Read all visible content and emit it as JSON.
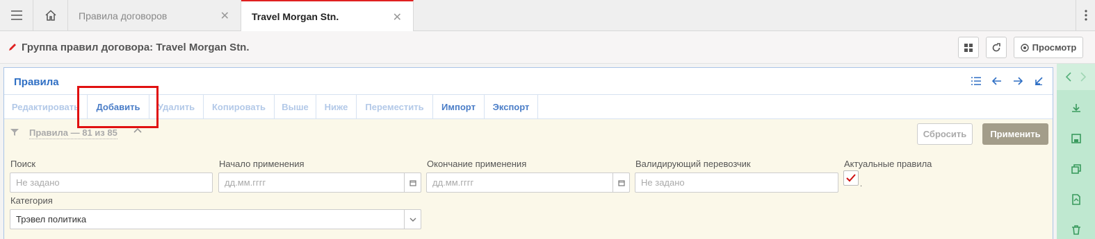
{
  "tabs": [
    {
      "label": "Правила договоров"
    },
    {
      "label": "Travel Morgan Stn."
    }
  ],
  "header": {
    "title": "Группа правил договора: Travel Morgan Stn.",
    "view_label": "Просмотр"
  },
  "panel": {
    "title": "Правила",
    "toolbar": [
      {
        "label": "Редактировать",
        "enabled": false
      },
      {
        "label": "Добавить",
        "enabled": true
      },
      {
        "label": "Удалить",
        "enabled": false
      },
      {
        "label": "Копировать",
        "enabled": false
      },
      {
        "label": "Выше",
        "enabled": false
      },
      {
        "label": "Ниже",
        "enabled": false
      },
      {
        "label": "Переместить",
        "enabled": false
      },
      {
        "label": "Импорт",
        "enabled": true
      },
      {
        "label": "Экспорт",
        "enabled": true
      }
    ]
  },
  "filter": {
    "summary": "Правила — 81 из 85",
    "reset_label": "Сбросить",
    "apply_label": "Применить",
    "search": {
      "label": "Поиск",
      "placeholder": "Не задано"
    },
    "start": {
      "label": "Начало применения",
      "placeholder": "дд.мм.гггг"
    },
    "end": {
      "label": "Окончание применения",
      "placeholder": "дд.мм.гггг"
    },
    "carrier": {
      "label": "Валидирующий перевозчик",
      "placeholder": "Не задано"
    },
    "actual": {
      "label": "Актуальные правила",
      "checked": true
    },
    "category": {
      "label": "Категория",
      "value": "Трэвел политика"
    }
  },
  "colors": {
    "accent": "#2f6fc4",
    "active_tab_border": "#e02020",
    "highlight": "#e01010",
    "filter_bg": "#fbf8e9",
    "sidebar_bg": "#bfe8d0"
  }
}
